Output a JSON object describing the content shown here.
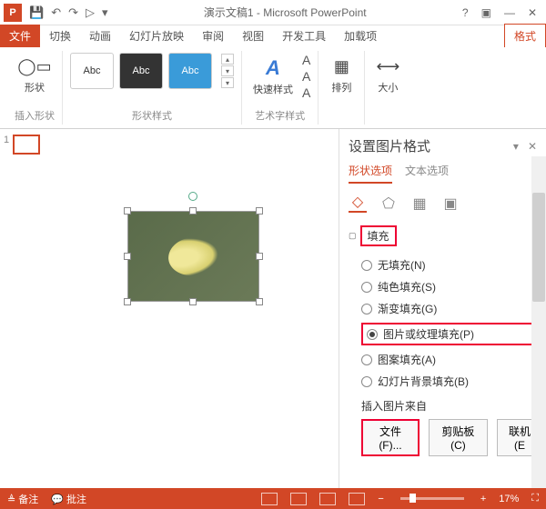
{
  "titlebar": {
    "app_letter": "P",
    "title": "演示文稿1 - Microsoft PowerPoint",
    "help": "?",
    "restore": "▣",
    "min": "—",
    "close": "✕"
  },
  "qat": {
    "save": "💾",
    "undo": "↶",
    "redo": "↷",
    "start": "▷",
    "more": "▾"
  },
  "tabs": {
    "file": "文件",
    "items": [
      "切换",
      "动画",
      "幻灯片放映",
      "审阅",
      "视图",
      "开发工具",
      "加载项"
    ],
    "format": "格式"
  },
  "ribbon": {
    "shapes": {
      "label": "形状",
      "group": "插入形状"
    },
    "styles": {
      "swatch": "Abc",
      "group": "形状样式"
    },
    "quick": {
      "label": "快速样式",
      "group": "艺术字样式"
    },
    "arrange": "排列",
    "size": "大小"
  },
  "thumb": {
    "num": "1"
  },
  "pane": {
    "title": "设置图片格式",
    "close": "✕",
    "down": "▾",
    "tab_shape": "形状选项",
    "tab_text": "文本选项",
    "section_fill": "填充",
    "options": {
      "none": "无填充(N)",
      "solid": "纯色填充(S)",
      "gradient": "渐变填充(G)",
      "picture": "图片或纹理填充(P)",
      "pattern": "图案填充(A)",
      "slidebg": "幻灯片背景填充(B)"
    },
    "insert_from": "插入图片来自",
    "btn_file": "文件(F)...",
    "btn_clip": "剪贴板(C)",
    "btn_online": "联机(E"
  },
  "status": {
    "notes": "备注",
    "comments": "批注",
    "zoom_out": "−",
    "zoom_in": "+",
    "zoom": "17%",
    "fit": "⛶"
  }
}
